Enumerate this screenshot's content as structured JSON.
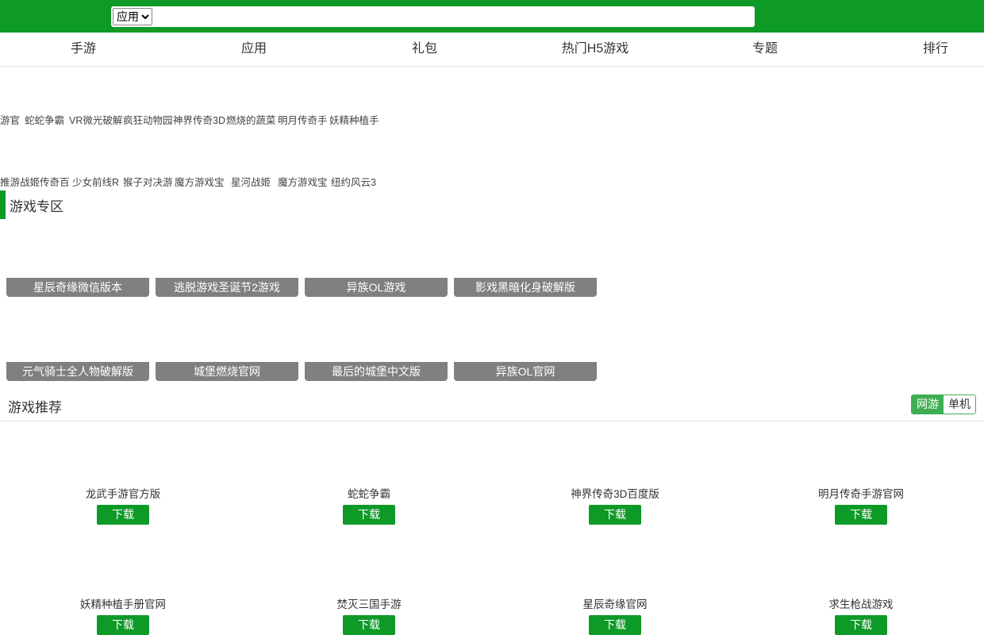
{
  "search": {
    "category_selected": "应用",
    "query_value": "",
    "placeholder": ""
  },
  "nav": {
    "items": [
      "手游",
      "应用",
      "礼包",
      "热门H5游戏",
      "专题",
      "排行"
    ]
  },
  "tags": {
    "row1": [
      "游官",
      "蛇蛇争霸",
      "VR微光破解",
      "疯狂动物园",
      "神界传奇3D",
      "燃烧的蔬菜",
      "明月传奇手",
      "妖精种植手"
    ],
    "row2": [
      "推游",
      "战姬传奇百",
      "少女前线R",
      "猴子对决游",
      "魔方游戏宝",
      "星河战姬",
      "魔方游戏宝",
      "纽约风云3"
    ]
  },
  "zone": {
    "title": "游戏专区",
    "tiles": [
      "星辰奇缘微信版本",
      "逃脱游戏圣诞节2游戏",
      "异族OL游戏",
      "影戏黑暗化身破解版",
      "元气骑士全人物破解版",
      "城堡燃烧官网",
      "最后的城堡中文版",
      "异族OL官网"
    ]
  },
  "recommend": {
    "title": "游戏推荐",
    "toggle_online": "网游",
    "toggle_single": "单机",
    "download_label": "下载",
    "games": [
      "龙武手游官方版",
      "蛇蛇争霸",
      "神界传奇3D百度版",
      "明月传奇手游官网",
      "妖精种植手册官网",
      "焚灭三国手游",
      "星辰奇缘官网",
      "求生枪战游戏"
    ]
  },
  "colors": {
    "brand_green": "#0e9a27",
    "toggle_green": "#3fae52",
    "tile_gray": "#808080"
  }
}
